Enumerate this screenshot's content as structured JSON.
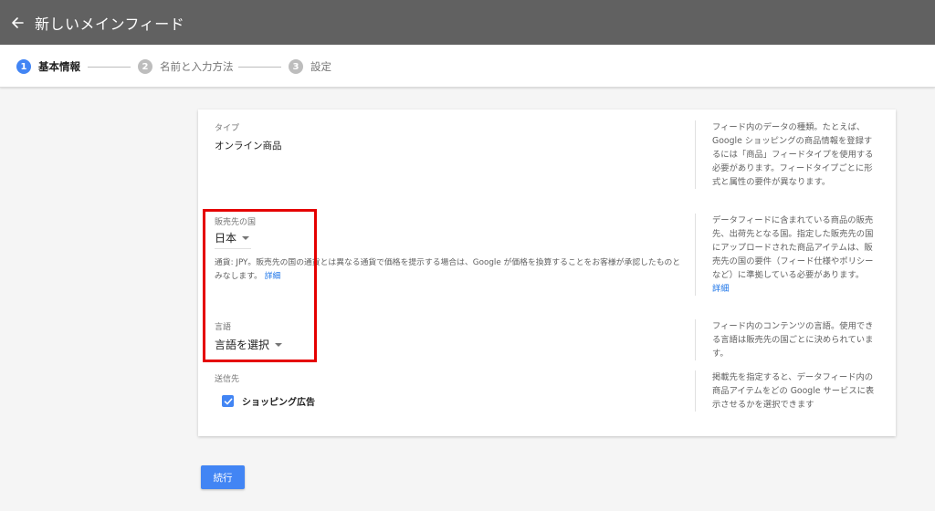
{
  "header": {
    "title": "新しいメインフィード"
  },
  "stepper": {
    "steps": [
      {
        "number": "1",
        "label": "基本情報"
      },
      {
        "number": "2",
        "label": "名前と入力方法"
      },
      {
        "number": "3",
        "label": "設定"
      }
    ]
  },
  "form": {
    "type": {
      "label": "タイプ",
      "value": "オンライン商品",
      "help": "フィード内のデータの種類。たとえば、Google ショッピングの商品情報を登録するには「商品」フィードタイプを使用する必要があります。フィードタイプごとに形式と属性の要件が異なります。"
    },
    "country": {
      "label": "販売先の国",
      "value": "日本",
      "note": "通貨: JPY。販売先の国の通貨とは異なる通貨で価格を提示する場合は、Google が価格を換算することをお客様が承認したものとみなします。",
      "note_link": "詳細",
      "help": "データフィードに含まれている商品の販売先、出荷先となる国。指定した販売先の国にアップロードされた商品アイテムは、販売先の国の要件（フィード仕様やポリシーなど）に準拠している必要があります。",
      "help_link": "詳細"
    },
    "language": {
      "label": "言語",
      "value": "言語を選択",
      "help": "フィード内のコンテンツの言語。使用できる言語は販売先の国ごとに決められています。"
    },
    "destination": {
      "label": "送信先",
      "checkbox_label": "ショッピング広告",
      "checked": true,
      "help": "掲載先を指定すると、データフィード内の商品アイテムをどの Google サービスに表示させるかを選択できます"
    }
  },
  "actions": {
    "continue_label": "続行"
  },
  "colors": {
    "appbar": "#616161",
    "accent": "#4285f4",
    "highlight": "#e50000"
  }
}
